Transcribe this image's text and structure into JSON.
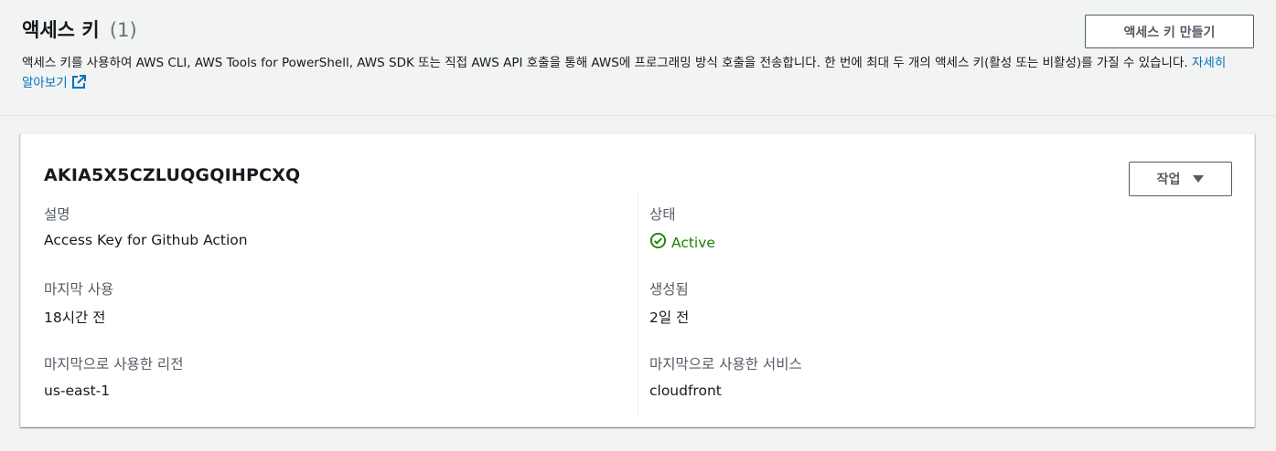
{
  "header": {
    "title": "액세스 키",
    "count": "(1)",
    "description": "액세스 키를 사용하여 AWS CLI, AWS Tools for PowerShell, AWS SDK 또는 직접 AWS API 호출을 통해 AWS에 프로그래밍 방식 호출을 전송합니다. 한 번에 최대 두 개의 액세스 키(활성 또는 비활성)를 가질 수 있습니다.",
    "learn_more": "자세히 알아보기",
    "create_button": "액세스 키 만들기"
  },
  "access_key": {
    "id": "AKIA5X5CZLUQGQIHPCXQ",
    "actions_button": "작업",
    "fields": {
      "description_label": "설명",
      "description_value": "Access Key for Github Action",
      "last_used_label": "마지막 사용",
      "last_used_value": "18시간 전",
      "last_region_label": "마지막으로 사용한 리전",
      "last_region_value": "us-east-1",
      "status_label": "상태",
      "status_value": "Active",
      "created_label": "생성됨",
      "created_value": "2일 전",
      "last_service_label": "마지막으로 사용한 서비스",
      "last_service_value": "cloudfront"
    }
  },
  "colors": {
    "link": "#0073bb",
    "active": "#1d8102",
    "label": "#545b64",
    "text": "#16191f",
    "page_bg": "#f2f3f3"
  },
  "icons": {
    "external_link": "external-link-icon",
    "status": "check-circle-icon",
    "dropdown": "caret-down-icon"
  }
}
